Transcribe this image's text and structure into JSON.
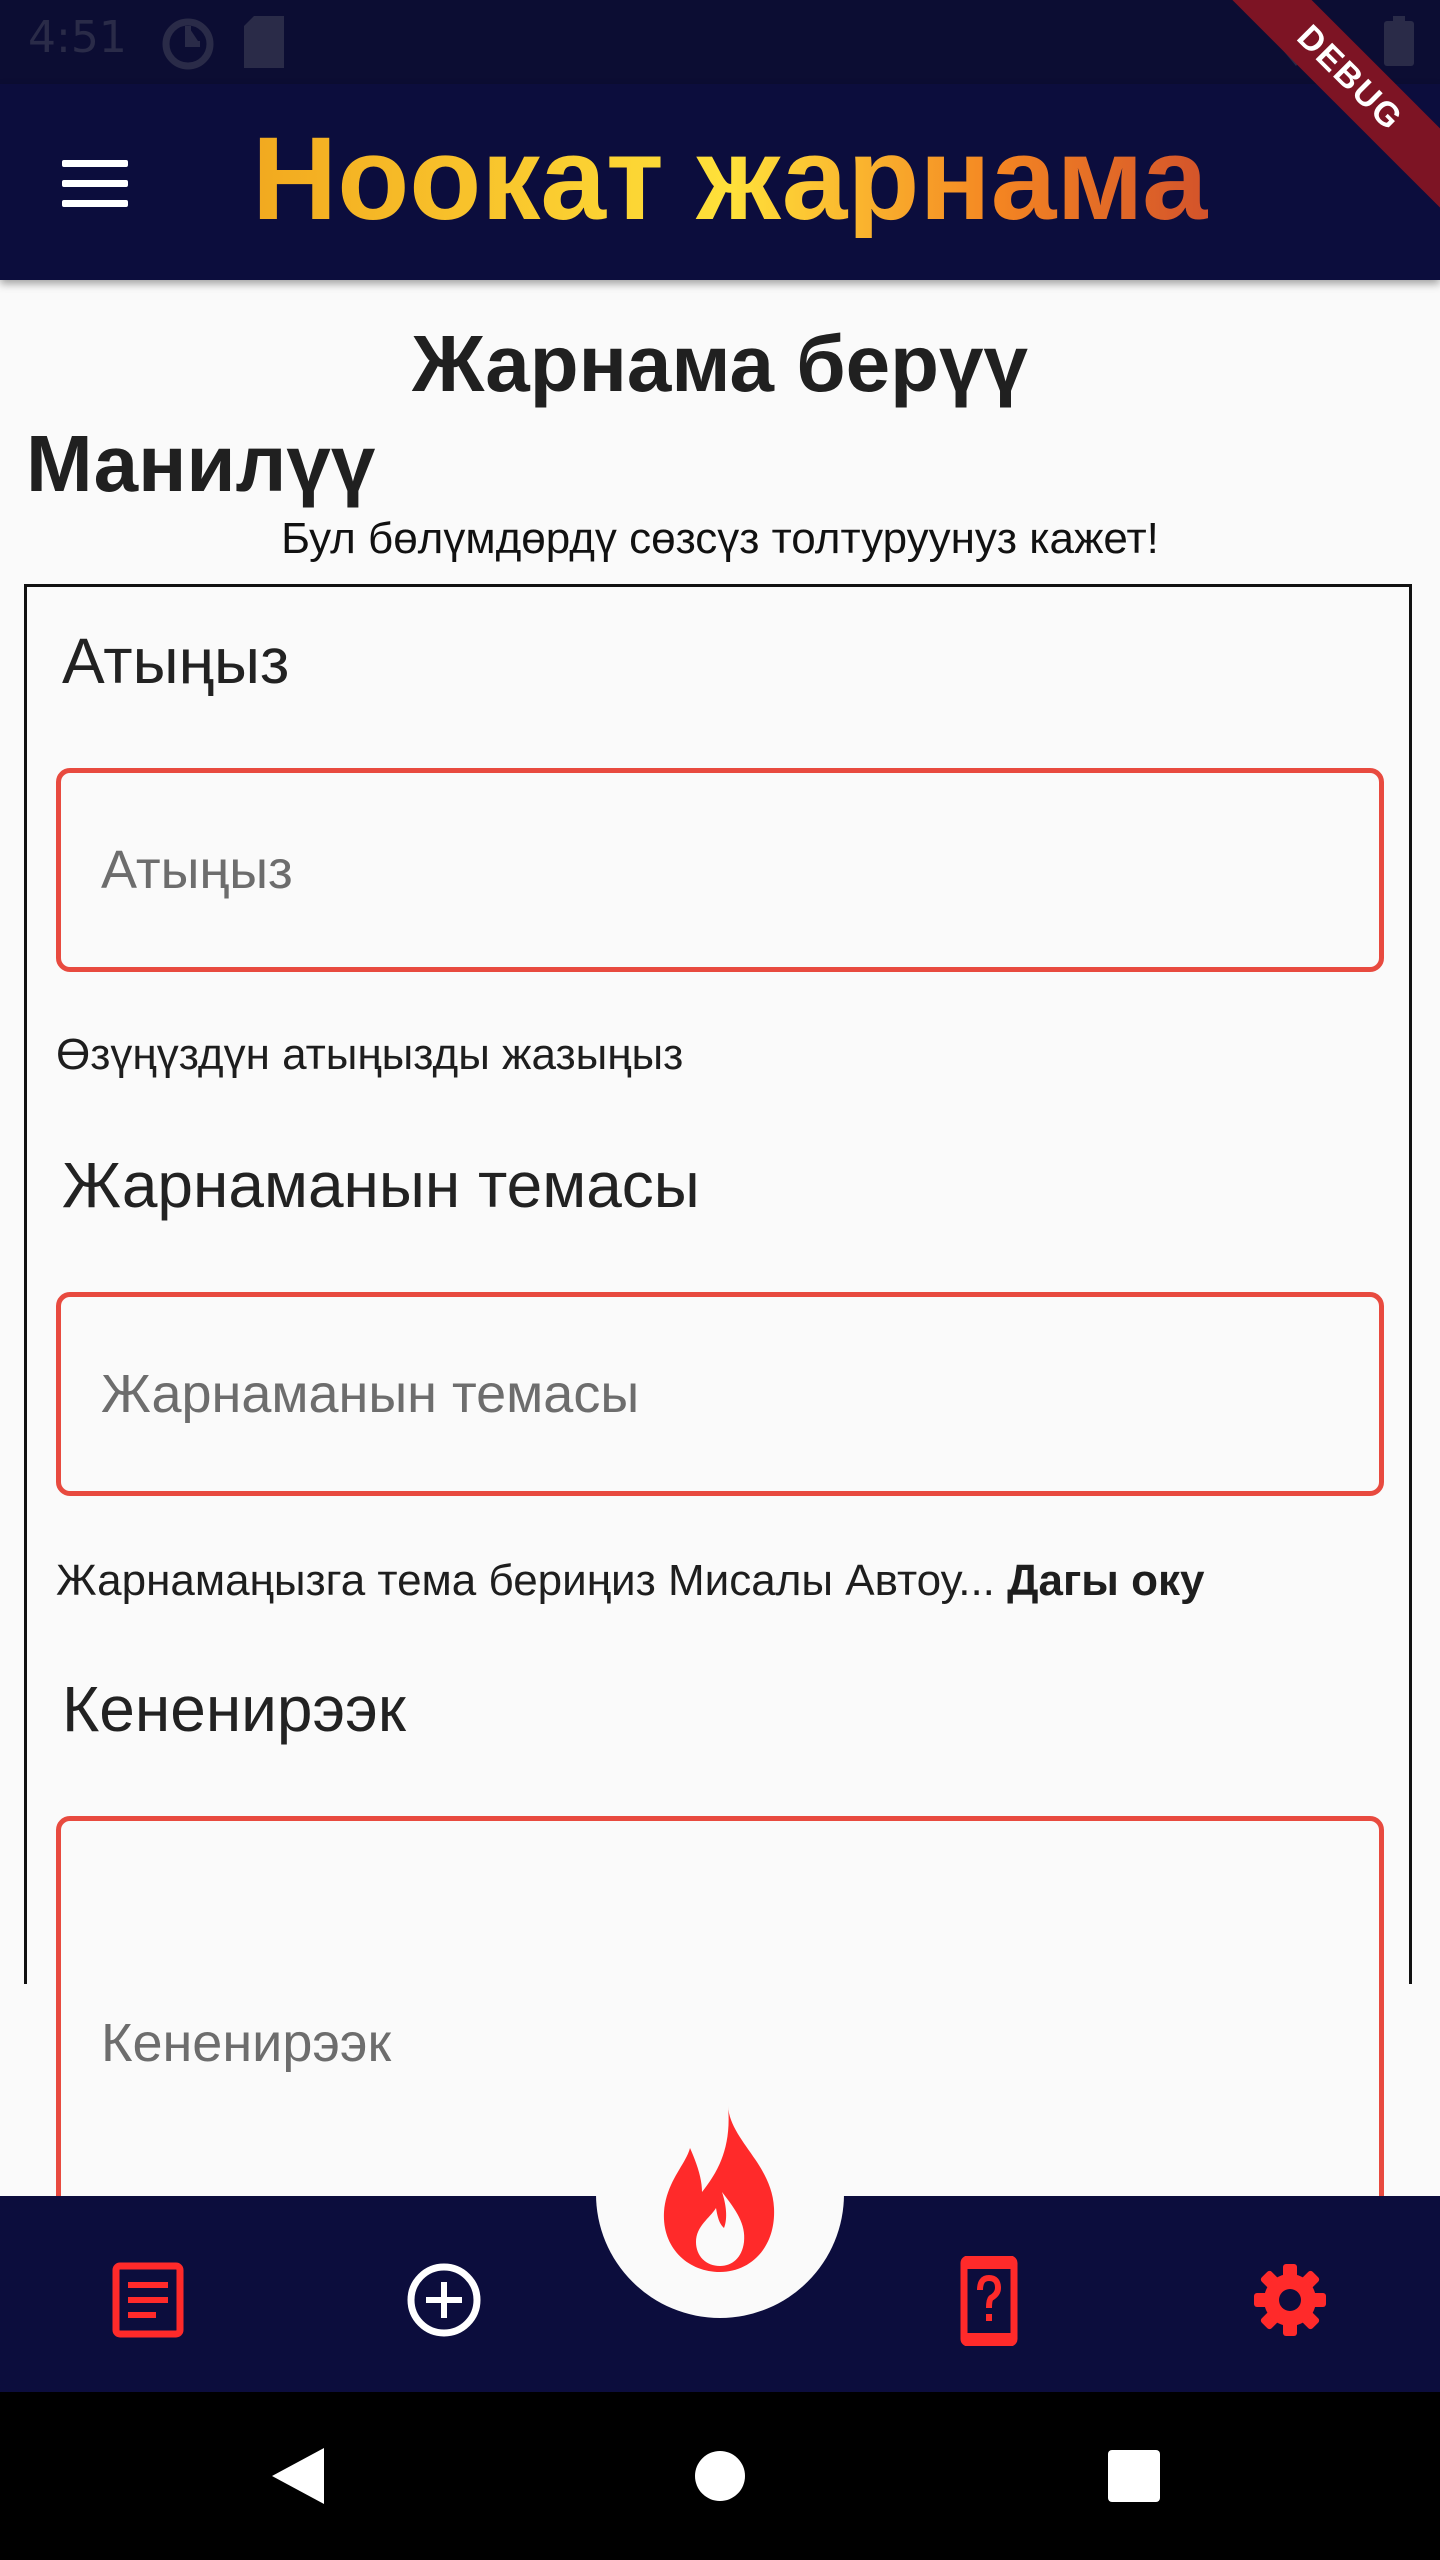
{
  "status_bar": {
    "time": "4:51",
    "icons": [
      "app-notification-icon",
      "sd-card-icon",
      "wifi-icon",
      "battery-icon"
    ],
    "debug_banner": "DEBUG"
  },
  "app_bar": {
    "menu_icon": "hamburger-menu-icon",
    "title": "Ноокат жарнама",
    "title_gradient": [
      "#f2a91f",
      "#ffe13a",
      "#f48522",
      "#d3532b"
    ],
    "background": "#0c0d3d"
  },
  "page": {
    "title": "Жарнама берүү",
    "section_title": "Манилүү",
    "section_note": "Бул бөлүмдөрдү сөзсүз толтуруунуз кажет!"
  },
  "form": {
    "name": {
      "label": "Атыңыз",
      "placeholder": "Атыңыз",
      "value": "",
      "helper": "Өзүңүздүн атыңызды жазыңыз"
    },
    "topic": {
      "label": "Жарнаманын темасы",
      "placeholder": "Жарнаманын темасы",
      "value": "",
      "helper": "Жарнамаңызга тема бериңиз Мисалы Автоу...",
      "helper_more": "Дагы оку"
    },
    "details": {
      "label": "Кененирээк",
      "placeholder": "Кененирээк",
      "value": ""
    },
    "error_border_color": "#e84a3f"
  },
  "bottom_nav": {
    "background": "#0c0d3d",
    "accent": "#ff2a2a",
    "items": [
      {
        "icon": "list-document-icon"
      },
      {
        "icon": "add-circle-icon"
      },
      {
        "icon": "fire-icon"
      },
      {
        "icon": "phone-help-icon"
      },
      {
        "icon": "settings-gear-icon"
      }
    ]
  },
  "system_nav": {
    "buttons": [
      "back-icon",
      "home-icon",
      "recents-icon"
    ]
  }
}
